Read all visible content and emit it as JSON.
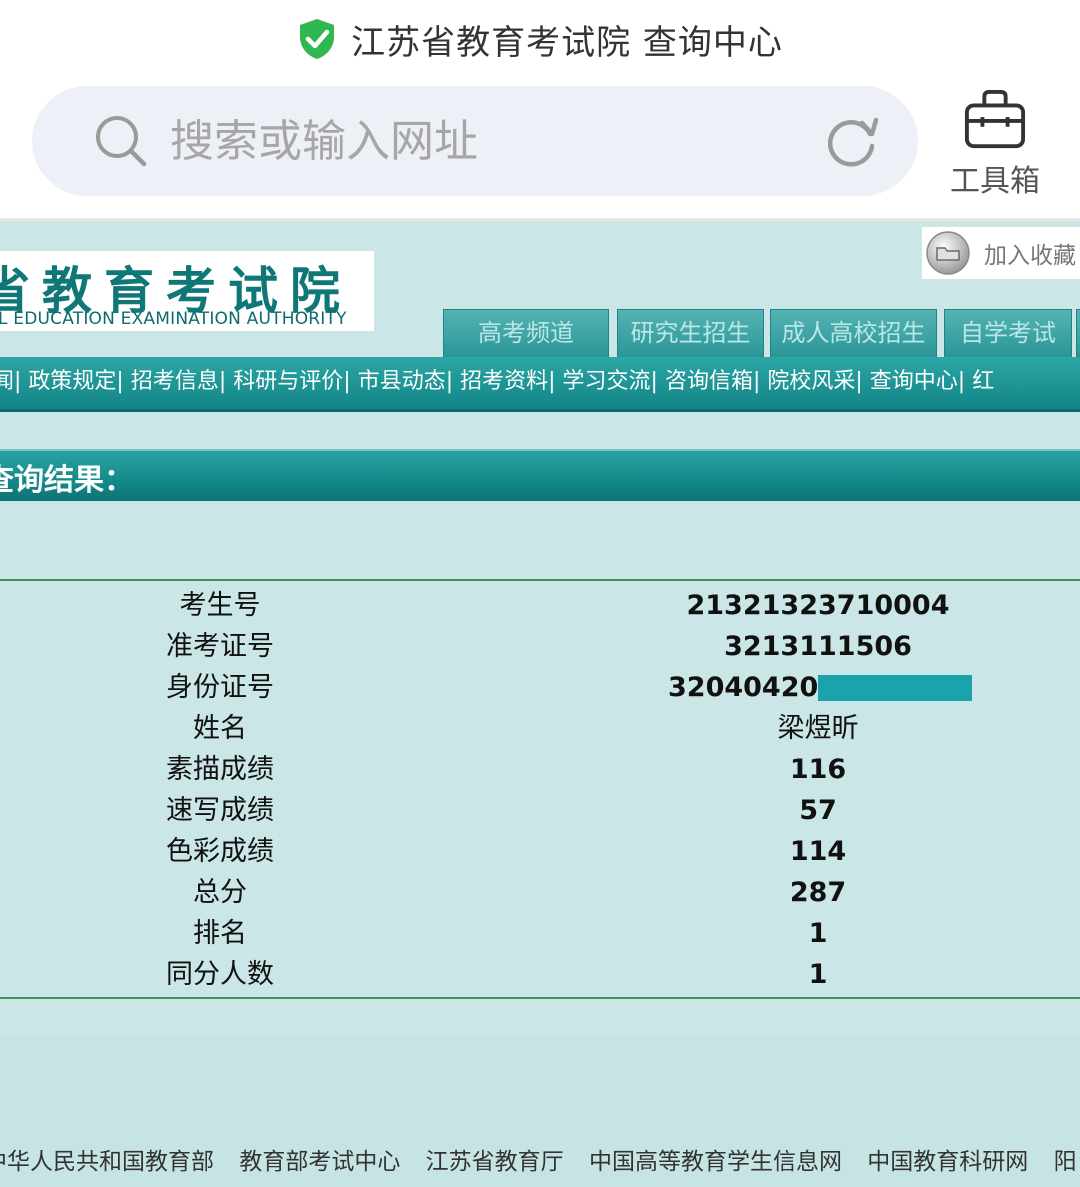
{
  "browser": {
    "site_title": "江苏省教育考试院 查询中心",
    "address_placeholder": "搜索或输入网址",
    "toolbox_label": "工具箱"
  },
  "site": {
    "logo_cn": "省教育考试院",
    "logo_en": "L EDUCATION EXAMINATION AUTHORITY",
    "bookmark_label": "加入收藏"
  },
  "tabs": [
    {
      "label": "高考频道"
    },
    {
      "label": "研究生招生"
    },
    {
      "label": "成人高校招生"
    },
    {
      "label": "自学考试"
    }
  ],
  "nav_items": [
    "闻|",
    "政策规定|",
    "招考信息|",
    "科研与评价|",
    "市县动态|",
    "招考资料|",
    "学习交流|",
    "咨询信箱|",
    "院校风采|",
    "查询中心|",
    "红"
  ],
  "result_title": "查询结果：",
  "results": [
    {
      "label": "考生号",
      "value": "21321323710004"
    },
    {
      "label": "准考证号",
      "value": "3213111506"
    },
    {
      "label": "身份证号",
      "value": "320404200"
    },
    {
      "label": "姓名",
      "value": "梁煜昕"
    },
    {
      "label": "素描成绩",
      "value": "116"
    },
    {
      "label": "速写成绩",
      "value": "57"
    },
    {
      "label": "色彩成绩",
      "value": "114"
    },
    {
      "label": "总分",
      "value": "287"
    },
    {
      "label": "排名",
      "value": "1"
    },
    {
      "label": "同分人数",
      "value": "1"
    }
  ],
  "footer_links": [
    "中华人民共和国教育部",
    "教育部考试中心",
    "江苏省教育厅",
    "中国高等教育学生信息网",
    "中国教育科研网",
    "阳"
  ],
  "colors": {
    "page_bg": "#cbe6e6",
    "teal_bar": "#14898a",
    "shield_green": "#2fb84f",
    "id_mask": "#1aa3ad"
  }
}
